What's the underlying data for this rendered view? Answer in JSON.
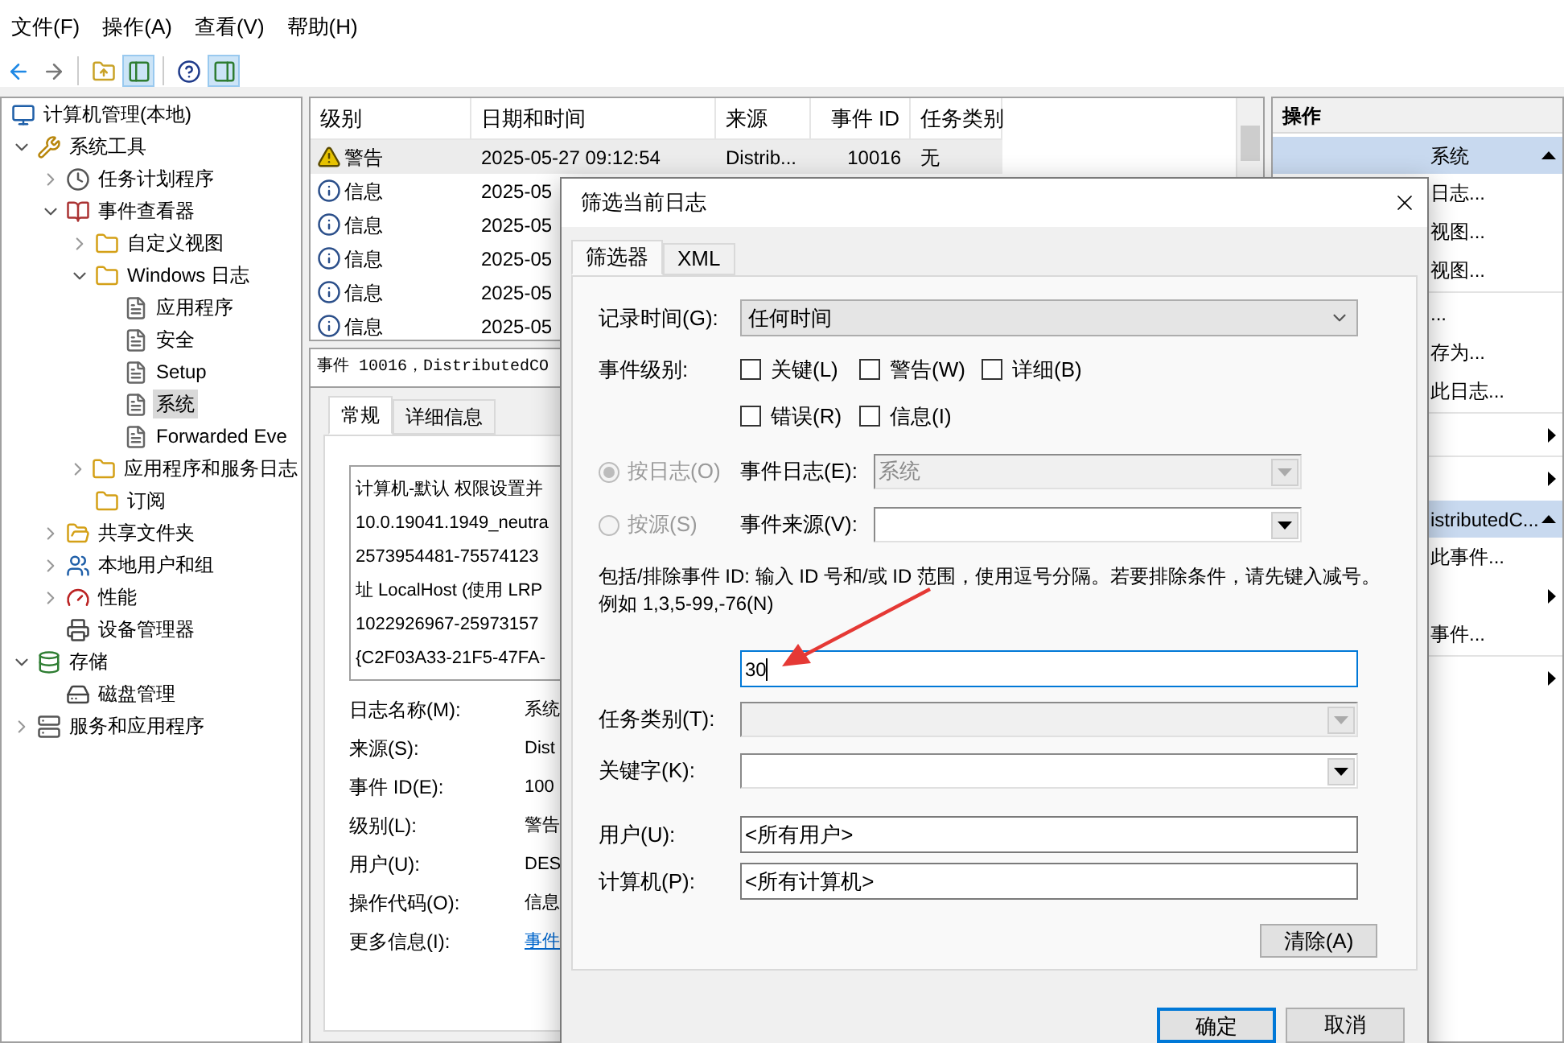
{
  "menu": [
    "文件(F)",
    "操作(A)",
    "查看(V)",
    "帮助(H)"
  ],
  "toolbar": [
    {
      "kind": "back",
      "pressed": false
    },
    {
      "kind": "forward",
      "pressed": false
    },
    {
      "kind": "up",
      "pressed": false
    },
    {
      "kind": "tree",
      "pressed": true
    },
    {
      "kind": "help",
      "pressed": false
    },
    {
      "kind": "action_pane",
      "pressed": true
    }
  ],
  "tree": [
    {
      "label": "计算机管理(本地)",
      "kind": "computer",
      "selected": false,
      "children": [
        {
          "label": "系统工具",
          "kind": "tools",
          "selected": false,
          "expanded": true,
          "children": [
            {
              "label": "任务计划程序",
              "kind": "clock",
              "selected": false,
              "expanded": false
            },
            {
              "label": "事件查看器",
              "kind": "viewer",
              "selected": false,
              "expanded": true,
              "children": [
                {
                  "label": "自定义视图",
                  "kind": "folder",
                  "selected": false,
                  "expanded": false
                },
                {
                  "label": "Windows 日志",
                  "kind": "folder",
                  "selected": false,
                  "expanded": true,
                  "children": [
                    {
                      "label": "应用程序",
                      "kind": "log",
                      "selected": false
                    },
                    {
                      "label": "安全",
                      "kind": "log",
                      "selected": false
                    },
                    {
                      "label": "Setup",
                      "kind": "log",
                      "selected": false
                    },
                    {
                      "label": "系统",
                      "kind": "log",
                      "selected": true
                    },
                    {
                      "label": "Forwarded Eve",
                      "kind": "log",
                      "selected": false
                    }
                  ]
                },
                {
                  "label": "应用程序和服务日志",
                  "kind": "folder",
                  "selected": false,
                  "expanded": false
                },
                {
                  "label": "订阅",
                  "kind": "folder",
                  "selected": false
                }
              ]
            },
            {
              "label": "共享文件夹",
              "kind": "share",
              "selected": false,
              "expanded": false
            },
            {
              "label": "本地用户和组",
              "kind": "users",
              "selected": false,
              "expanded": false
            },
            {
              "label": "性能",
              "kind": "perf",
              "selected": false,
              "expanded": false
            },
            {
              "label": "设备管理器",
              "kind": "device",
              "selected": false
            }
          ]
        },
        {
          "label": "存储",
          "kind": "storage",
          "selected": false,
          "expanded": true,
          "children": [
            {
              "label": "磁盘管理",
              "kind": "disk",
              "selected": false
            }
          ]
        },
        {
          "label": "服务和应用程序",
          "kind": "services",
          "selected": false,
          "expanded": false
        }
      ]
    }
  ],
  "event_list": {
    "columns": [
      "级别",
      "日期和时间",
      "来源",
      "事件 ID",
      "任务类别"
    ],
    "rows": [
      {
        "kind": "warning",
        "level": "警告",
        "date": "2025-05-27 09:12:54",
        "source": "Distrib...",
        "event_id": "10016",
        "task": "无",
        "selected": true
      },
      {
        "kind": "info",
        "level": "信息",
        "date": "2025-05",
        "selected": false
      },
      {
        "kind": "info",
        "level": "信息",
        "date": "2025-05",
        "selected": false
      },
      {
        "kind": "info",
        "level": "信息",
        "date": "2025-05",
        "selected": false
      },
      {
        "kind": "info",
        "level": "信息",
        "date": "2025-05",
        "selected": false
      },
      {
        "kind": "info",
        "level": "信息",
        "date": "2025-05",
        "selected": false
      }
    ]
  },
  "event_detail": {
    "title": "事件 10016，DistributedCO",
    "tabs": [
      {
        "label": "常规",
        "selected": true
      },
      {
        "label": "详细信息",
        "selected": false
      }
    ],
    "message_lines": [
      "计算机-默认 权限设置并",
      "10.0.19041.1949_neutra",
      "2573954481-75574123",
      "址 LocalHost (使用 LRP",
      "1022926967-25973157",
      "{C2F03A33-21F5-47FA-"
    ],
    "fields": [
      {
        "label": "日志名称(M):",
        "value": "系统",
        "kind": "text"
      },
      {
        "label": "来源(S):",
        "value": "Dist",
        "kind": "text"
      },
      {
        "label": "事件 ID(E):",
        "value": "100",
        "kind": "text"
      },
      {
        "label": "级别(L):",
        "value": "警告",
        "kind": "text"
      },
      {
        "label": "用户(U):",
        "value": "DES",
        "kind": "text"
      },
      {
        "label": "操作代码(O):",
        "value": "信息",
        "kind": "text"
      },
      {
        "label": "更多信息(I):",
        "value": "事件",
        "kind": "link"
      }
    ]
  },
  "actions": {
    "title": "操作",
    "items": [
      {
        "kind": "section",
        "label": "系统",
        "expanded": true
      },
      {
        "kind": "item",
        "label": "日志..."
      },
      {
        "kind": "item",
        "label": "视图..."
      },
      {
        "kind": "item",
        "label": "视图..."
      },
      {
        "kind": "divider"
      },
      {
        "kind": "item",
        "label": "..."
      },
      {
        "kind": "item",
        "label": "存为..."
      },
      {
        "kind": "item",
        "label": "此日志..."
      },
      {
        "kind": "divider"
      },
      {
        "kind": "submenu"
      },
      {
        "kind": "divider"
      },
      {
        "kind": "submenu"
      },
      {
        "kind": "section",
        "label": "istributedC...",
        "expanded": true
      },
      {
        "kind": "item",
        "label": "此事件..."
      },
      {
        "kind": "submenu"
      },
      {
        "kind": "item",
        "label": "事件..."
      },
      {
        "kind": "divider"
      },
      {
        "kind": "submenu"
      }
    ]
  },
  "filter_dialog": {
    "title": "筛选当前日志",
    "tabs": [
      {
        "label": "筛选器",
        "selected": true
      },
      {
        "label": "XML",
        "selected": false
      }
    ],
    "logged": {
      "label": "记录时间(G):",
      "value": "任何时间"
    },
    "event_level": {
      "label": "事件级别:",
      "options": [
        {
          "label": "关键(L)",
          "checked": false
        },
        {
          "label": "警告(W)",
          "checked": false
        },
        {
          "label": "详细(B)",
          "checked": false
        },
        {
          "label": "错误(R)",
          "checked": false
        },
        {
          "label": "信息(I)",
          "checked": false
        }
      ]
    },
    "scope": [
      {
        "label": "按日志(O)",
        "selected": true,
        "disabled": true,
        "field_label": "事件日志(E):",
        "field_value": "系统",
        "field_disabled": true
      },
      {
        "label": "按源(S)",
        "selected": false,
        "disabled": true,
        "field_label": "事件来源(V):",
        "field_disabled": false
      }
    ],
    "event_ids": {
      "description": "包括/排除事件 ID: 输入 ID 号和/或 ID 范围，使用逗号分隔。若要排除条件，请先键入减号。例如 1,3,5-99,-76(N)",
      "value": "30"
    },
    "task_category": {
      "label": "任务类别(T):",
      "disabled": true
    },
    "keywords": {
      "label": "关键字(K):",
      "disabled": false
    },
    "user": {
      "label": "用户(U):",
      "value": "<所有用户>"
    },
    "computer": {
      "label": "计算机(P):",
      "value": "<所有计算机>"
    },
    "clear_button": "清除(A)",
    "buttons": [
      {
        "label": "确定",
        "default": true
      },
      {
        "label": "取消",
        "default": false
      }
    ]
  }
}
